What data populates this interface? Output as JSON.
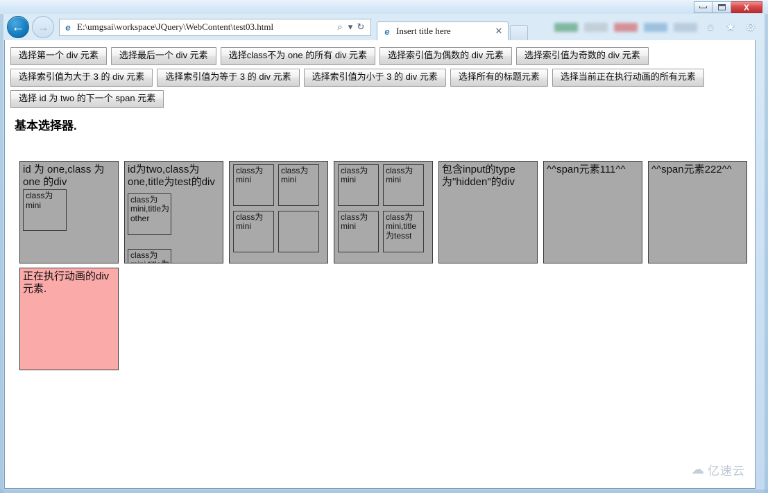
{
  "window": {
    "controls": {
      "minimize": "—",
      "maximize": "□",
      "close": "X"
    }
  },
  "browser": {
    "back_icon": "←",
    "forward_icon": "→",
    "favicon": "e",
    "url": "E:\\umgsai\\workspace\\JQuery\\WebContent\\test03.html",
    "search_icon": "⌕",
    "search_dropdown_icon": "▾",
    "refresh_icon": "↻",
    "tab": {
      "favicon": "e",
      "title": "Insert title here",
      "close_icon": "✕"
    },
    "new_tab_label": "",
    "toolbar_icons": {
      "home": "⌂",
      "favorites": "★",
      "settings": "⚙"
    }
  },
  "page": {
    "title": "基本选择器.",
    "button_rows": [
      [
        "选择第一个 div 元素",
        "选择最后一个 div 元素",
        "选择class不为 one 的所有 div 元素",
        "选择索引值为偶数的 div 元素",
        "选择索引值为奇数的 div 元素"
      ],
      [
        "选择索引值为大于 3 的 div 元素",
        "选择索引值为等于 3 的 div 元素",
        "选择索引值为小于 3 的 div 元素",
        "选择所有的标题元素",
        "选择当前正在执行动画的所有元素"
      ],
      [
        "选择 id 为 two 的下一个 span 元素"
      ]
    ],
    "boxes": [
      {
        "caption": "id 为 one,class 为 one 的div",
        "minis": [
          "class为mini"
        ]
      },
      {
        "caption": "id为two,class为one,title为test的div",
        "minis": [
          "class为mini,title为other",
          "class为mini,title为test"
        ]
      },
      {
        "caption": "",
        "minis": [
          "class为mini",
          "class为mini",
          "class为mini",
          ""
        ]
      },
      {
        "caption": "",
        "minis": [
          "class为mini",
          "class为mini",
          "class为mini",
          "class为mini,title为tesst"
        ]
      },
      {
        "caption": "包含input的type为\"hidden\"的div",
        "minis": []
      },
      {
        "caption": "^^span元素111^^",
        "minis": []
      },
      {
        "caption": "^^span元素222^^",
        "minis": []
      }
    ],
    "animated_box": {
      "caption": "正在执行动画的div元素."
    }
  },
  "watermark": {
    "cloud_icon": "☁",
    "text": "亿速云"
  },
  "colors": {
    "box_gray": "#a9a9a9",
    "animated_pink": "#fbaaaa",
    "border_dark": "#3a3a3a",
    "chrome_blue": "#cfe3f4",
    "close_red": "#d94a4a"
  }
}
